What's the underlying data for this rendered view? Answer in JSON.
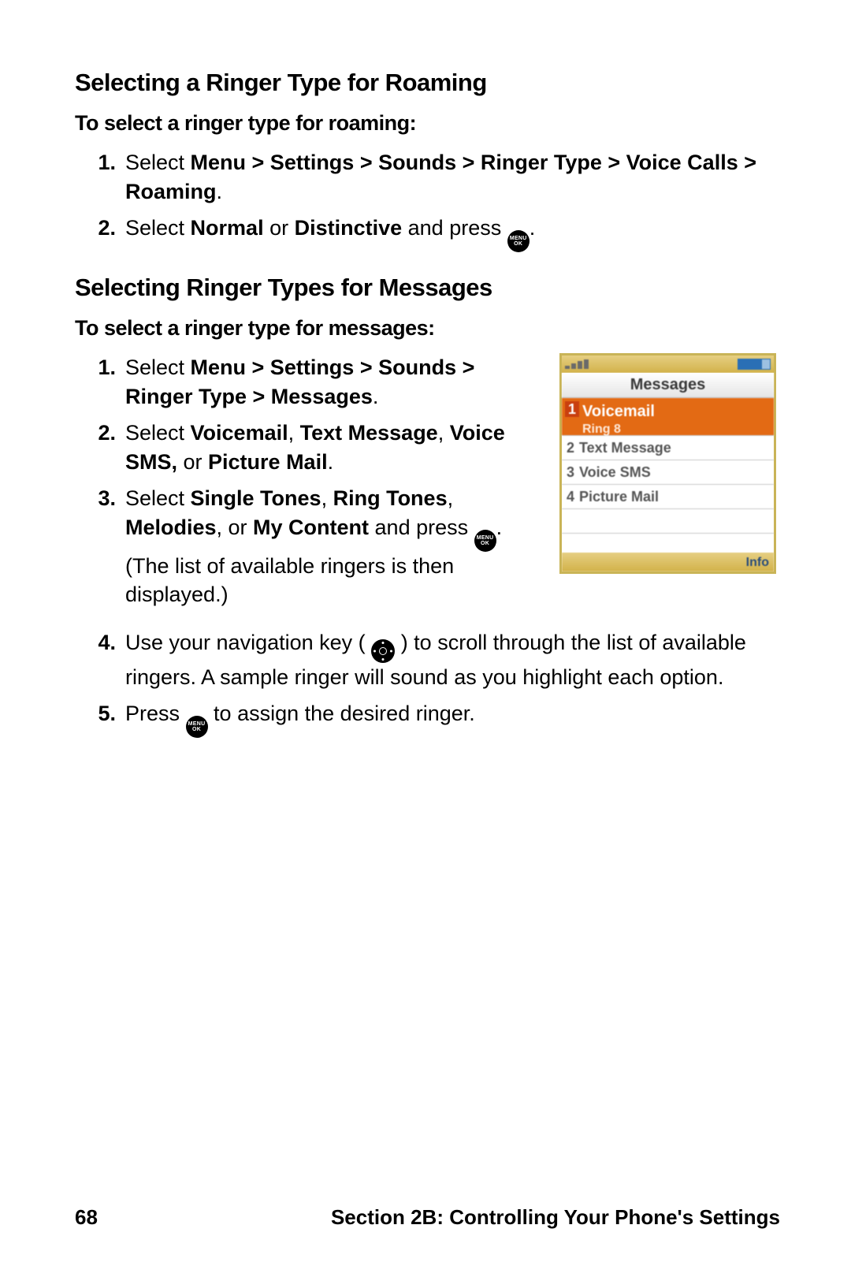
{
  "sectionA": {
    "heading": "Selecting a Ringer Type for Roaming",
    "subhead": "To select a ringer type for roaming:",
    "steps": {
      "s1_num": "1.",
      "s1a": "Select ",
      "s1b": "Menu > Settings > Sounds > Ringer Type > Voice Calls > Roaming",
      "s1c": ".",
      "s2_num": "2.",
      "s2a": "Select ",
      "s2b": "Normal",
      "s2c": " or ",
      "s2d": "Distinctive",
      "s2e": " and press ",
      "s2f": "."
    }
  },
  "sectionB": {
    "heading": "Selecting Ringer Types for Messages",
    "subhead": "To select a ringer type for messages:",
    "steps": {
      "s1_num": "1.",
      "s1a": "Select ",
      "s1b": "Menu > Settings > Sounds > Ringer Type > Messages",
      "s1c": ".",
      "s2_num": "2.",
      "s2a": "Select ",
      "s2b": "Voicemail",
      "s2c": ", ",
      "s2d": "Text Message",
      "s2e": ", ",
      "s2f": "Voice SMS,",
      "s2g": " or ",
      "s2h": "Picture Mail",
      "s2i": ".",
      "s3_num": "3.",
      "s3a": "Select ",
      "s3b": "Single Tones",
      "s3c": ", ",
      "s3d": "Ring Tones",
      "s3e": ", ",
      "s3f": "Melodies",
      "s3g": ", or ",
      "s3h": "My Content",
      "s3i": " and press ",
      "s3j": ". (The list of available ringers is then displayed.)",
      "s4_num": "4.",
      "s4a": "Use your navigation key (",
      "s4b": ") to scroll through the list of available ringers. A sample ringer will sound as you highlight each option.",
      "s5_num": "5.",
      "s5a": "Press ",
      "s5b": " to assign the desired ringer."
    }
  },
  "icon": {
    "menu_top": "MENU",
    "menu_bot": "OK"
  },
  "phone": {
    "title": "Messages",
    "items": [
      {
        "n": "1",
        "label": "Voicemail",
        "sub": "Ring 8",
        "selected": true
      },
      {
        "n": "2",
        "label": "Text Message"
      },
      {
        "n": "3",
        "label": "Voice SMS"
      },
      {
        "n": "4",
        "label": "Picture Mail"
      }
    ],
    "softkey": "Info"
  },
  "footer": {
    "page": "68",
    "section": "Section 2B: Controlling Your Phone's Settings"
  }
}
